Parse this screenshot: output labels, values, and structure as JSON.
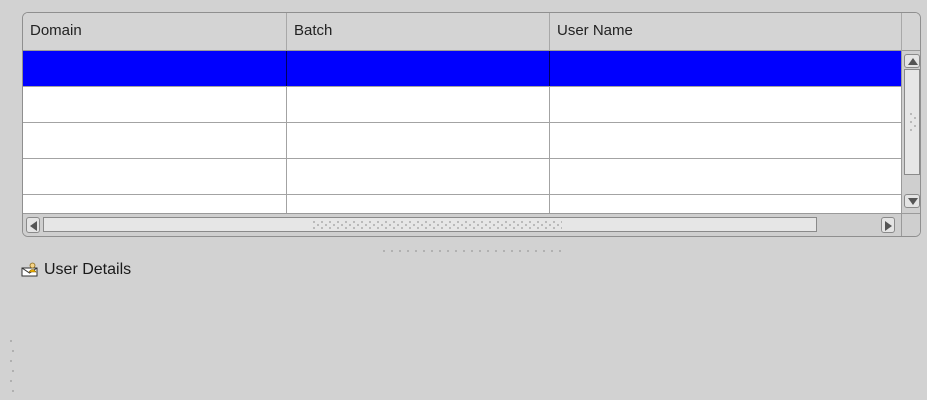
{
  "table": {
    "columns": [
      "Domain",
      "Batch",
      "User Name"
    ],
    "rows": [
      {
        "domain": "",
        "batch": "",
        "user_name": "",
        "selected": true
      },
      {
        "domain": "",
        "batch": "",
        "user_name": "",
        "selected": false
      },
      {
        "domain": "",
        "batch": "",
        "user_name": "",
        "selected": false
      },
      {
        "domain": "",
        "batch": "",
        "user_name": "",
        "selected": false
      },
      {
        "domain": "",
        "batch": "",
        "user_name": "",
        "selected": false
      }
    ]
  },
  "details": {
    "label": "User Details",
    "icon": "user-details-icon"
  },
  "colors": {
    "background": "#d2d2d2",
    "selection": "#0000ff",
    "header": "#d4d4d4"
  }
}
